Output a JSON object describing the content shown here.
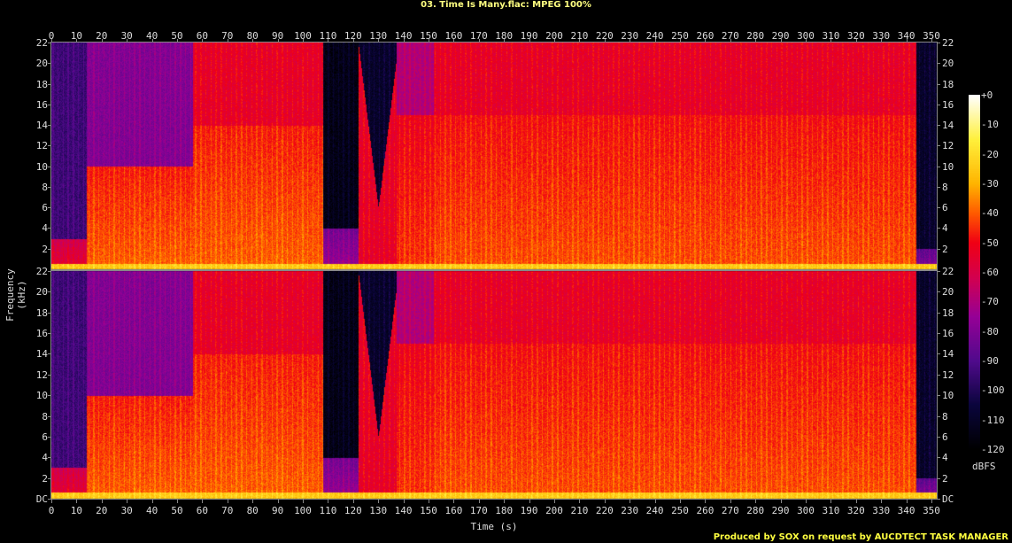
{
  "title": "03. Time Is Many.flac: MPEG 100%",
  "credit": "Produced by SOX on request by AUCDTECT TASK MANAGER",
  "chart_data": {
    "type": "heatmap",
    "title": "03. Time Is Many.flac: MPEG 100%",
    "xlabel": "Time (s)",
    "ylabel": "Frequency (kHz)",
    "xlim": [
      0,
      352
    ],
    "ylim": [
      0,
      22
    ],
    "x_ticks": [
      0,
      10,
      20,
      30,
      40,
      50,
      60,
      70,
      80,
      90,
      100,
      110,
      120,
      130,
      140,
      150,
      160,
      170,
      180,
      190,
      200,
      210,
      220,
      230,
      240,
      250,
      260,
      270,
      280,
      290,
      300,
      310,
      320,
      330,
      340,
      350
    ],
    "y_ticks": [
      "DC",
      "2",
      "4",
      "6",
      "8",
      "10",
      "12",
      "14",
      "16",
      "18",
      "20",
      "22"
    ],
    "channels": 2,
    "colorbar": {
      "label": "dBFS",
      "range": [
        -120,
        0
      ],
      "ticks": [
        "+0",
        "-10",
        "-20",
        "-30",
        "-40",
        "-50",
        "-60",
        "-70",
        "-80",
        "-90",
        "-100",
        "-110",
        "-120"
      ]
    },
    "segments": [
      {
        "t": [
          0,
          14
        ],
        "low_db": -55,
        "high_db": -95,
        "split_khz": 3
      },
      {
        "t": [
          14,
          56
        ],
        "low_db": -40,
        "high_db": -80,
        "split_khz": 10
      },
      {
        "t": [
          56,
          108
        ],
        "low_db": -40,
        "high_db": -55,
        "split_khz": 14
      },
      {
        "t": [
          108,
          122
        ],
        "low_db": -75,
        "high_db": -115,
        "split_khz": 4
      },
      {
        "t": [
          122,
          137
        ],
        "low_db": -55,
        "high_db": -110,
        "split_khz": 6
      },
      {
        "t": [
          137,
          152
        ],
        "low_db": -45,
        "high_db": -70,
        "split_khz": 15
      },
      {
        "t": [
          152,
          344
        ],
        "low_db": -42,
        "high_db": -55,
        "split_khz": 15
      },
      {
        "t": [
          344,
          352
        ],
        "low_db": -80,
        "high_db": -110,
        "split_khz": 2
      }
    ]
  }
}
